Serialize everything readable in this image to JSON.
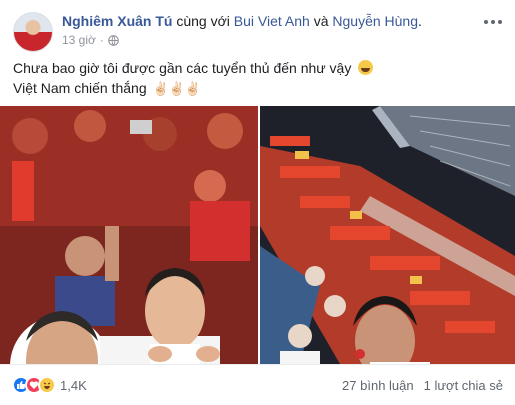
{
  "post": {
    "author": "Nghiêm Xuân Tú",
    "with_text": "cùng với",
    "tagged_1": "Bui Viet Anh",
    "and_text": "và",
    "tagged_2": "Nguyễn Hùng",
    "end_punct": ".",
    "time": "13 giờ",
    "separator": "·",
    "privacy_icon": "globe-icon",
    "line1": "Chưa bao giờ tôi được gần các tuyển thủ đến như vậy",
    "line2": "Việt Nam chiến thắng",
    "victory": "✌🏻✌🏻✌🏻"
  },
  "footer": {
    "reaction_icons": [
      "like-icon",
      "love-icon",
      "haha-icon"
    ],
    "reaction_count": "1,4K",
    "comments": "27 bình luận",
    "shares": "1 lượt chia sẻ"
  },
  "colors": {
    "link": "#385898",
    "meta": "#90949c",
    "like": "#1877f2",
    "love": "#f33e58",
    "haha": "#f7c948"
  }
}
